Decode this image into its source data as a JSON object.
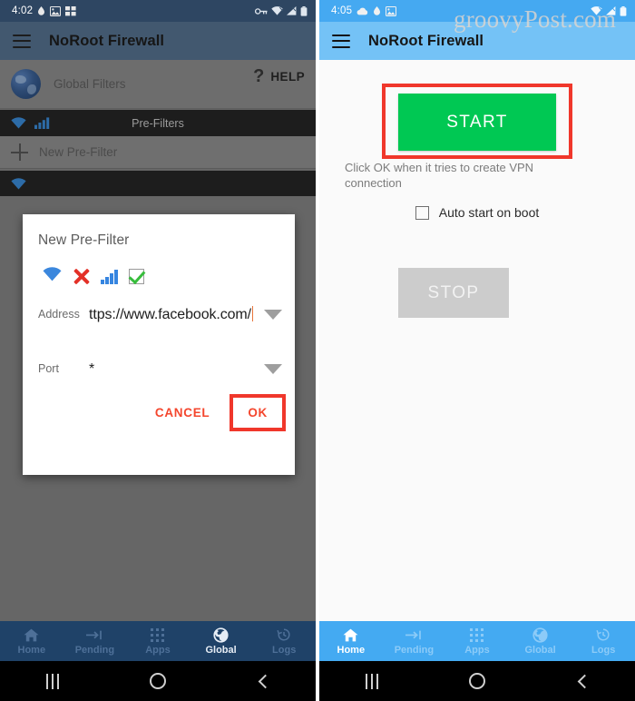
{
  "left_phone": {
    "status_bar": {
      "time": "4:02",
      "icons": [
        "location-icon",
        "image-icon",
        "apps-icon"
      ],
      "right_icons": [
        "vpn-key-icon",
        "wifi-icon",
        "signal-icon",
        "battery-icon"
      ]
    },
    "app_bar": {
      "menu_icon": "hamburger-menu-icon",
      "title": "NoRoot Firewall"
    },
    "global_row": {
      "icon": "globe-icon",
      "label": "Global Filters",
      "help_icon": "question-mark-icon",
      "help_label": "HELP"
    },
    "prefilters_header": {
      "label": "Pre-Filters",
      "icons": [
        "wifi-icon",
        "signal-bars-icon"
      ]
    },
    "new_prefilter_row": {
      "icon": "plus-icon",
      "label": "New Pre-Filter"
    },
    "dialog": {
      "title": "New Pre-Filter",
      "icons": [
        "wifi-icon",
        "red-x-icon",
        "signal-bars-icon",
        "green-check-checkbox-icon"
      ],
      "address_label": "Address",
      "address_value": "ttps://www.facebook.com/",
      "port_label": "Port",
      "port_value": "*",
      "cancel_label": "CANCEL",
      "ok_label": "OK",
      "accent_color": "#f4462d",
      "underline_color": "#e8743b"
    },
    "bottom_nav": {
      "items": [
        {
          "label": "Home",
          "icon": "home-icon",
          "active": false
        },
        {
          "label": "Pending",
          "icon": "arrow-to-line-icon",
          "active": false
        },
        {
          "label": "Apps",
          "icon": "apps-grid-icon",
          "active": false
        },
        {
          "label": "Global",
          "icon": "globe-icon",
          "active": true
        },
        {
          "label": "Logs",
          "icon": "history-clock-icon",
          "active": false
        }
      ],
      "bar_color": "#1f4268"
    },
    "system_nav": {
      "recent": "recents-icon",
      "home": "home-circle-icon",
      "back": "back-chevron-icon"
    }
  },
  "right_phone": {
    "status_bar": {
      "time": "4:05",
      "icons": [
        "cloud-icon",
        "location-icon",
        "image-icon"
      ],
      "right_icons": [
        "wifi-icon",
        "signal-icon",
        "battery-icon"
      ]
    },
    "app_bar": {
      "menu_icon": "hamburger-menu-icon",
      "title": "NoRoot Firewall"
    },
    "watermark": "groovyPost.com",
    "start_button": {
      "label": "START",
      "color": "#00c853"
    },
    "hint": "Click OK when it tries to create VPN connection",
    "auto_start": {
      "label": "Auto start on boot",
      "checked": false
    },
    "stop_button": {
      "label": "STOP",
      "color": "#cccccc"
    },
    "bottom_nav": {
      "items": [
        {
          "label": "Home",
          "icon": "home-icon",
          "active": true
        },
        {
          "label": "Pending",
          "icon": "arrow-to-line-icon",
          "active": false
        },
        {
          "label": "Apps",
          "icon": "apps-grid-icon",
          "active": false
        },
        {
          "label": "Global",
          "icon": "globe-icon",
          "active": false
        },
        {
          "label": "Logs",
          "icon": "history-clock-icon",
          "active": false
        }
      ],
      "bar_color": "#44aaf2"
    },
    "system_nav": {
      "recent": "recents-icon",
      "home": "home-circle-icon",
      "back": "back-chevron-icon"
    }
  }
}
